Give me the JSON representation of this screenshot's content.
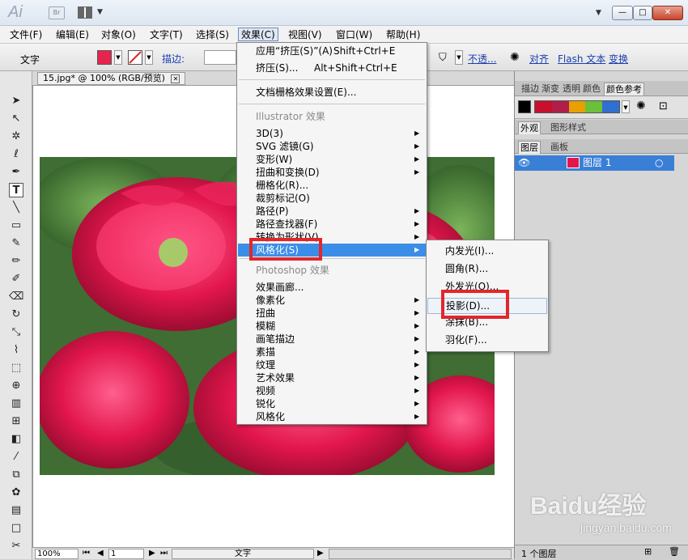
{
  "titlebar": {
    "app_logo": "Ai",
    "br_label": "Br",
    "win_buttons": [
      "—",
      "□",
      "✕"
    ]
  },
  "menubar": [
    "文件(F)",
    "编辑(E)",
    "对象(O)",
    "文字(T)",
    "选择(S)",
    "效果(C)",
    "视图(V)",
    "窗口(W)",
    "帮助(H)"
  ],
  "control_bar": {
    "mode": "文字",
    "stroke_label": "描边:",
    "opacity_link": "不透...",
    "align_link": "对齐",
    "flash_link": "Flash 文本",
    "transform_link": "变换",
    "fill_color": "#e8244e"
  },
  "document": {
    "tab_title": "15.jpg* @ 100% (RGB/预览)",
    "tab_close": "✕",
    "status": {
      "zoom": "100%",
      "page": "1",
      "mode": "文字"
    }
  },
  "effects_menu": {
    "top": [
      {
        "label": "应用“挤压(S)”(A)",
        "shortcut": "Shift+Ctrl+E"
      },
      {
        "label": "挤压(S)...",
        "shortcut": "Alt+Shift+Ctrl+E"
      }
    ],
    "raster_settings": "文档栅格效果设置(E)...",
    "illustrator_header": "Illustrator 效果",
    "illustrator_items": [
      {
        "label": "3D(3)",
        "sub": true
      },
      {
        "label": "SVG 滤镜(G)",
        "sub": true
      },
      {
        "label": "变形(W)",
        "sub": true
      },
      {
        "label": "扭曲和变换(D)",
        "sub": true
      },
      {
        "label": "栅格化(R)...",
        "sub": false
      },
      {
        "label": "裁剪标记(O)",
        "sub": false
      },
      {
        "label": "路径(P)",
        "sub": true
      },
      {
        "label": "路径查找器(F)",
        "sub": true
      },
      {
        "label": "转换为形状(V)",
        "sub": true
      },
      {
        "label": "风格化(S)",
        "sub": true
      }
    ],
    "photoshop_header": "Photoshop 效果",
    "photoshop_items": [
      {
        "label": "效果画廊...",
        "sub": false
      },
      {
        "label": "像素化",
        "sub": true
      },
      {
        "label": "扭曲",
        "sub": true
      },
      {
        "label": "模糊",
        "sub": true
      },
      {
        "label": "画笔描边",
        "sub": true
      },
      {
        "label": "素描",
        "sub": true
      },
      {
        "label": "纹理",
        "sub": true
      },
      {
        "label": "艺术效果",
        "sub": true
      },
      {
        "label": "视频",
        "sub": true
      },
      {
        "label": "锐化",
        "sub": true
      },
      {
        "label": "风格化",
        "sub": true
      }
    ]
  },
  "stylize_submenu": [
    "内发光(I)...",
    "圆角(R)...",
    "外发光(O)...",
    "投影(D)...",
    "涂抹(B)...",
    "羽化(F)..."
  ],
  "right_panel": {
    "top_tabs": [
      "描边",
      "渐变",
      "透明",
      "颜色",
      "颜色参考"
    ],
    "appearance_tabs": [
      "外观",
      "图形样式"
    ],
    "layer_tabs": [
      "图层",
      "画板"
    ],
    "layer_name": "图层 1",
    "layer_count": "1 个图层",
    "guide_colors": [
      "#c8102e",
      "#b01e4a",
      "#e8a000",
      "#6bbf3a",
      "#2f6fd0"
    ]
  },
  "watermark": {
    "brand": "Baidu经验",
    "url": "jingyan.baidu.com"
  }
}
